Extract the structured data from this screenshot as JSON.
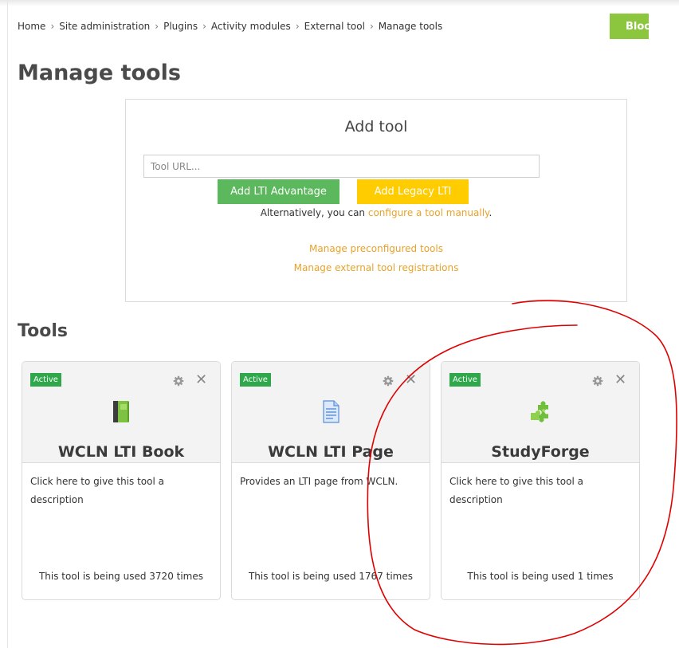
{
  "breadcrumb": {
    "items": [
      "Home",
      "Site administration",
      "Plugins",
      "Activity modules",
      "External tool",
      "Manage tools"
    ]
  },
  "header": {
    "button_label": "Bloc"
  },
  "page": {
    "title": "Manage tools"
  },
  "add_tool": {
    "heading": "Add tool",
    "url_placeholder": "Tool URL...",
    "url_value": "",
    "advantage_button": "Add LTI Advantage",
    "legacy_button": "Add Legacy LTI",
    "alt_prefix": "Alternatively, you can ",
    "alt_link": "configure a tool manually",
    "alt_suffix": ".",
    "manage_preconfigured": "Manage preconfigured tools",
    "manage_registrations": "Manage external tool registrations"
  },
  "tools": {
    "title": "Tools",
    "cards": [
      {
        "status": "Active",
        "name": "WCLN LTI Book",
        "description": "Click here to give this tool a description",
        "usage": "This tool is being used 3720 times",
        "icon": "book-icon"
      },
      {
        "status": "Active",
        "name": "WCLN LTI Page",
        "description": "Provides an LTI page from WCLN.",
        "usage": "This tool is being used 1767 times",
        "icon": "page-icon"
      },
      {
        "status": "Active",
        "name": "StudyForge",
        "description": "Click here to give this tool a description",
        "usage": "This tool is being used 1 times",
        "icon": "puzzle-icon"
      }
    ]
  },
  "colors": {
    "accent_green": "#8cc63f",
    "advantage_green": "#5cb85c",
    "legacy_yellow": "#ffcc00",
    "link_orange": "#e8a22b",
    "badge_green": "#2ea84a",
    "annotation_red": "#e00000"
  }
}
